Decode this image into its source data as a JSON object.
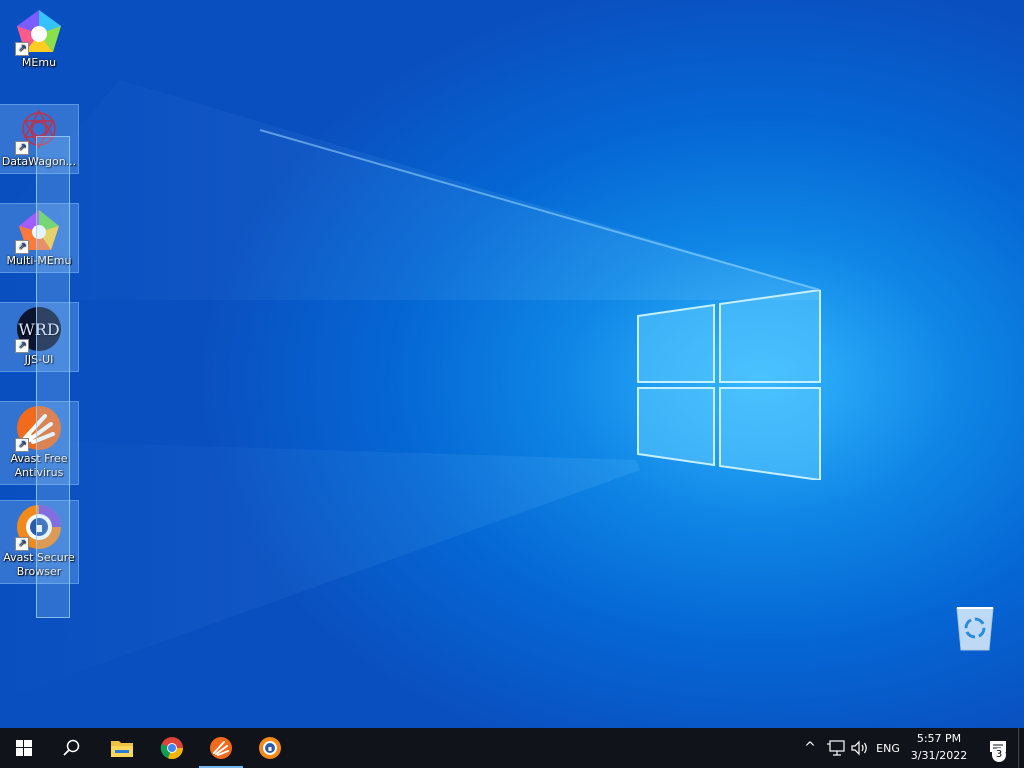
{
  "desktop": {
    "icons": [
      {
        "label": "MEmu",
        "icon": "memu-icon"
      },
      {
        "label": "DataWagon...",
        "icon": "datawagon-icon"
      },
      {
        "label": "Multi-MEmu",
        "icon": "multi-memu-icon"
      },
      {
        "label": "JJS-UI",
        "icon": "jjs-ui-icon"
      },
      {
        "label": "Avast Free Antivirus",
        "icon": "avast-antivirus-icon"
      },
      {
        "label": "Avast Secure Browser",
        "icon": "avast-secure-browser-icon"
      }
    ],
    "jjs_icon_text": "WRD",
    "recycle_bin": {
      "icon": "recycle-bin-icon"
    },
    "shortcut_arrow": "↗"
  },
  "taskbar": {
    "start": {
      "icon": "windows-start-icon"
    },
    "search": {
      "icon": "search-icon"
    },
    "pinned": [
      {
        "icon": "file-explorer-icon"
      },
      {
        "icon": "chrome-icon"
      },
      {
        "icon": "avast-antivirus-icon"
      },
      {
        "icon": "avast-secure-browser-icon"
      }
    ],
    "tray": {
      "chevron": "^",
      "language": "ENG",
      "time": "5:57 PM",
      "date": "3/31/2022",
      "notification_count": "3"
    }
  },
  "colors": {
    "taskbar": "#10131a",
    "accent": "#76b9ed",
    "avast_orange": "#f26a1b"
  }
}
